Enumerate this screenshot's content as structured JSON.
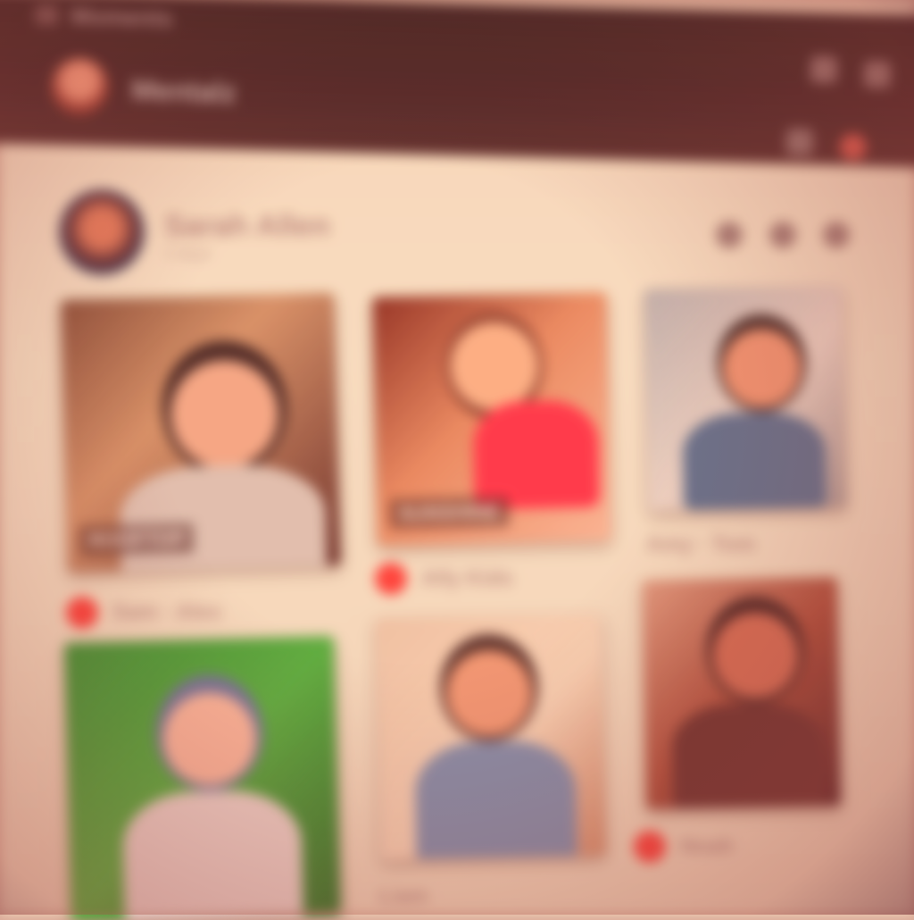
{
  "app": {
    "tab_label": "Moments",
    "account_name": "Mentalz"
  },
  "profile": {
    "name": "Sarah Allen",
    "subtitle": "2 days"
  },
  "photos": [
    {
      "caption": "ROOFTOP",
      "likes": "Sam · Alex"
    },
    {
      "caption": "SUNSHINE",
      "likes": "Ally Kids"
    },
    {
      "caption": "",
      "likes": "Amy · Tom"
    },
    {
      "caption": "",
      "likes": ""
    },
    {
      "caption": "",
      "likes": "Liam"
    },
    {
      "caption": "",
      "likes": "Noah"
    }
  ],
  "colors": {
    "accent": "#e0413f",
    "bar": "#2a1518",
    "background": "#f4e4cf"
  },
  "icons": {
    "heart": "heart-icon",
    "settings": "gear-icon",
    "more": "more-icon"
  }
}
